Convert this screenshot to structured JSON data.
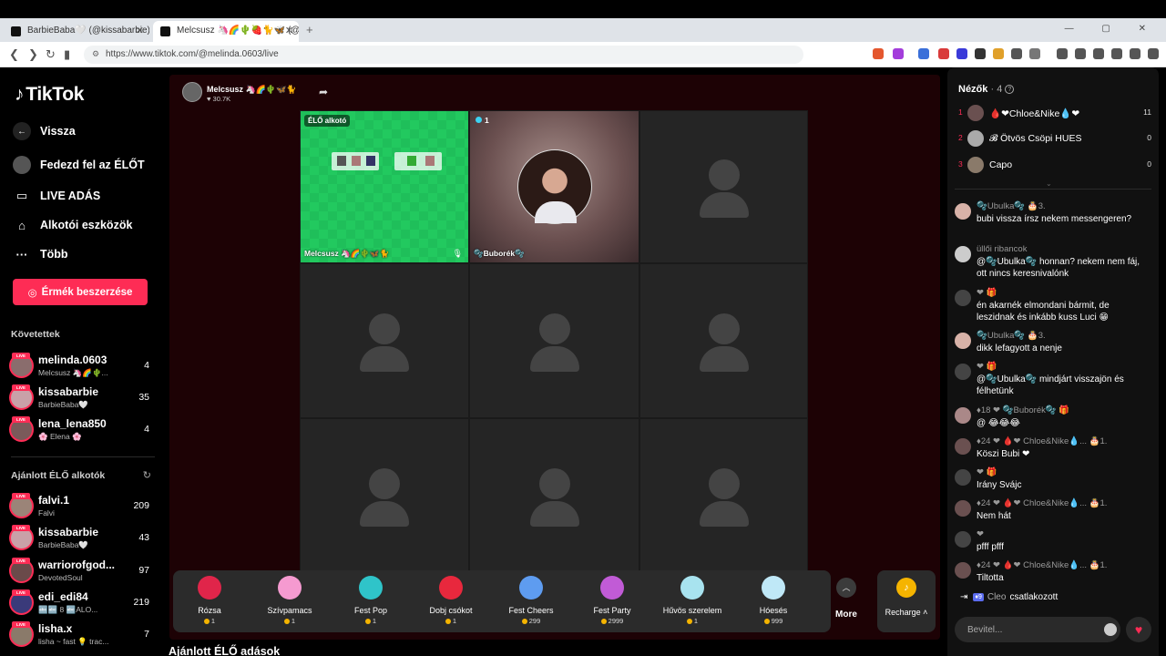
{
  "browser": {
    "tabs": [
      {
        "title": "BarbieBaba🤍 (@kissabarbie) ÉLŐ"
      },
      {
        "title": "Melcsusz 🦄🌈🌵🍓🐈🦋 (@m"
      }
    ],
    "new_tab": "+",
    "url": "https://www.tiktok.com/@melinda.0603/live",
    "window_controls": "— ▢ ✕"
  },
  "sidebar": {
    "logo": "TikTok",
    "back": "Vissza",
    "explore_live": "Fedezd fel az ÉLŐT",
    "live_studio": "LIVE ADÁS",
    "creator_tools": "Alkotói eszközök",
    "more": "Több",
    "coins_button": "Érmék beszerzése",
    "following_title": "Követettek",
    "following": [
      {
        "name": "melinda.0603",
        "sub": "Melcsusz 🦄🌈🌵...",
        "count": "4"
      },
      {
        "name": "kissabarbie",
        "sub": "BarbieBaba🤍",
        "count": "35"
      },
      {
        "name": "lena_lena850",
        "sub": "🌸 Elena 🌸",
        "count": "4"
      }
    ],
    "recommended_title": "Ajánlott ÉLŐ alkotók",
    "recommended": [
      {
        "name": "falvi.1",
        "sub": "Falvi",
        "count": "209"
      },
      {
        "name": "kissabarbie",
        "sub": "BarbieBaba🤍",
        "count": "43"
      },
      {
        "name": "warriorofgod...",
        "sub": "DevotedSoul",
        "count": "97"
      },
      {
        "name": "edi_edi84",
        "sub": "🔤🔤 8 🔤ALO...",
        "count": "219"
      },
      {
        "name": "lisha.x",
        "sub": "lisha ~ fast 💡 trac...",
        "count": "7"
      }
    ],
    "live_tag": "LIVE"
  },
  "stream": {
    "host_name": "Melcsusz 🦄🌈🌵🦋🐈",
    "host_likes": "♥ 30.7K",
    "host_tag": "ÉLŐ alkotó",
    "host_cell_name": "Melcsusz 🦄🌈🌵🦋🐈",
    "guest_viewers": "1",
    "guest_name": "🫧Buborék🫧",
    "recommended_title": "Ajánlott ÉLŐ adások"
  },
  "gifts": [
    {
      "name": "Rózsa",
      "price": "1",
      "color": "#e0254a"
    },
    {
      "name": "Szívpamacs",
      "price": "1",
      "color": "#f59ad0"
    },
    {
      "name": "Fest Pop",
      "price": "1",
      "color": "#2fc4c9"
    },
    {
      "name": "Dobj csókot",
      "price": "1",
      "color": "#e8283d"
    },
    {
      "name": "Fest Cheers",
      "price": "299",
      "color": "#5e9cf0"
    },
    {
      "name": "Fest Party",
      "price": "2999",
      "color": "#c15bd6"
    },
    {
      "name": "Hűvös szerelem",
      "price": "1",
      "color": "#a8e3ef"
    },
    {
      "name": "Hóesés",
      "price": "999",
      "color": "#bfe8f7"
    }
  ],
  "gift_more": "More",
  "recharge": "Recharge",
  "viewers_panel": {
    "title": "Nézők",
    "count": "· 4",
    "ranks": [
      {
        "n": "1",
        "name": "🩸❤Chloe&Nike💧❤",
        "value": "11"
      },
      {
        "n": "2",
        "name": "𝓑 Ötvös Csöpi HUES",
        "value": "0"
      },
      {
        "n": "3",
        "name": "Capo",
        "value": "0"
      }
    ]
  },
  "chat": [
    {
      "user": "🫧Ubulka🫧 🎂3.",
      "text": "bubi vissza írsz nekem messengeren?"
    },
    {
      "user": "üllői ribancok",
      "text": "@🫧Ubulka🫧 honnan? nekem nem fáj, ott nincs keresnivalónk"
    },
    {
      "user": "❤ 🎁",
      "text": "én akarnék elmondani bármit, de leszidnak és inkább kuss Luci 😁"
    },
    {
      "user": "🫧Ubulka🫧 🎂3.",
      "text": "dikk lefagyott a nenje"
    },
    {
      "user": "❤ 🎁",
      "text": "@🫧Ubulka🫧 mindjárt visszajön és félhetünk"
    },
    {
      "user": "♦18 ❤ 🫧Buborék🫧 🎁",
      "text": "@ 😂😂😂"
    },
    {
      "user": "♦24 ❤ 🩸❤ Chloe&Nike💧... 🎂1.",
      "text": "Köszi Bubi ❤"
    },
    {
      "user": "❤ 🎁",
      "text": "Irány Svájc"
    },
    {
      "user": "♦24 ❤ 🩸❤ Chloe&Nike💧... 🎂1.",
      "text": "Nem hát"
    },
    {
      "user": "❤",
      "text": "pfff pfff"
    },
    {
      "user": "♦24 ❤ 🩸❤ Chloe&Nike💧... 🎂1.",
      "text": "Tiltotta"
    }
  ],
  "joined": {
    "badge": "♦9",
    "name": "Cleo",
    "text": "csatlakozott"
  },
  "input_placeholder": "Bevitel..."
}
